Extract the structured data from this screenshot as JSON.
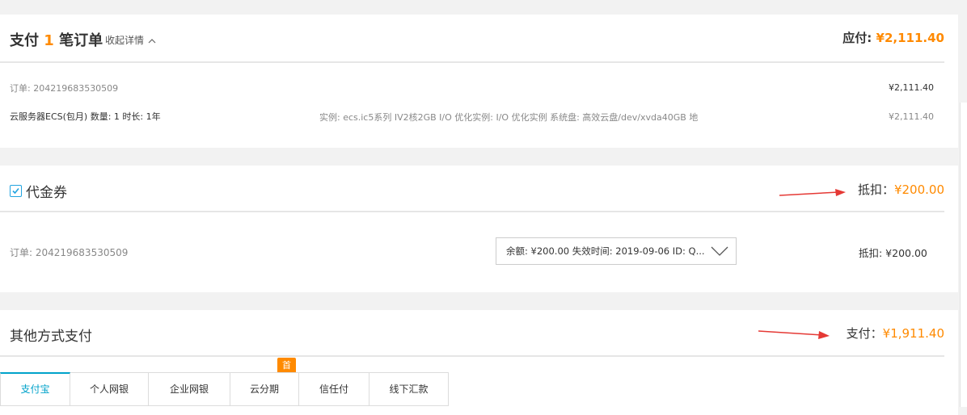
{
  "order_summary": {
    "title_prefix": "支付 ",
    "order_count": "1",
    "title_suffix": " 笔订单",
    "collapse_label": "收起详情",
    "payable_label": "应付: ",
    "payable_amount": "¥2,111.40",
    "order_id_line": "订单: 204219683530509",
    "order_total": "¥2,111.40",
    "product_line": "云服务器ECS(包月) 数量: 1 时长: 1年",
    "product_spec": "实例: ecs.ic5系列 IV2核2GB I/O 优化实例: I/O 优化实例 系统盘: 高效云盘/dev/xvda40GB 地",
    "product_price": "¥2,111.40"
  },
  "voucher": {
    "checked": true,
    "label": "代金券",
    "deduct_label": "抵扣：",
    "deduct_amount": "¥200.00",
    "order_id_line": "订单: 204219683530509",
    "selected_option": "余额: ¥200.00 失效时间: 2019-09-06 ID: Q...",
    "row_deduct": "抵扣: ¥200.00"
  },
  "other_payment": {
    "label": "其他方式支付",
    "pay_label": "支付：",
    "pay_amount": "¥1,911.40",
    "badge": "首",
    "tabs": [
      {
        "label": "支付宝",
        "active": true
      },
      {
        "label": "个人网银",
        "active": false
      },
      {
        "label": "企业网银",
        "active": false
      },
      {
        "label": "云分期",
        "active": false
      },
      {
        "label": "信任付",
        "active": false
      },
      {
        "label": "线下汇款",
        "active": false
      }
    ]
  },
  "colors": {
    "accent": "#ff8a00",
    "tab_active": "#00a2ca",
    "arrow": "#e53935"
  }
}
